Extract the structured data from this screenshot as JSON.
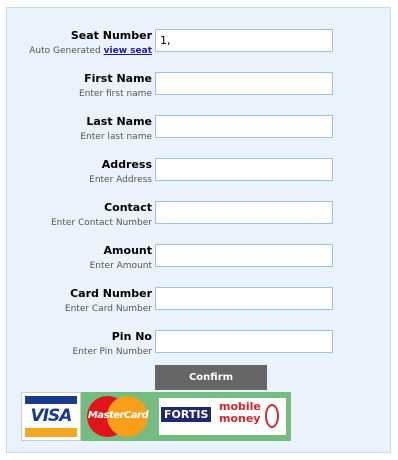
{
  "form": {
    "fields": [
      {
        "key": "seat",
        "label": "Seat Number",
        "hint": "Auto Generated",
        "hint_link": "view seat",
        "value": "1,",
        "placeholder": ""
      },
      {
        "key": "first_name",
        "label": "First Name",
        "hint": "Enter first name",
        "value": "",
        "placeholder": ""
      },
      {
        "key": "last_name",
        "label": "Last Name",
        "hint": "Enter last name",
        "value": "",
        "placeholder": ""
      },
      {
        "key": "address",
        "label": "Address",
        "hint": "Enter Address",
        "value": "",
        "placeholder": ""
      },
      {
        "key": "contact",
        "label": "Contact",
        "hint": "Enter Contact Number",
        "value": "",
        "placeholder": ""
      },
      {
        "key": "amount",
        "label": "Amount",
        "hint": "Enter Amount",
        "value": "",
        "placeholder": ""
      },
      {
        "key": "card_number",
        "label": "Card Number",
        "hint": "Enter Card Number",
        "value": "",
        "placeholder": ""
      },
      {
        "key": "pin",
        "label": "Pin No",
        "hint": "Enter Pin Number",
        "value": "",
        "placeholder": ""
      }
    ],
    "confirm_label": "Confirm"
  },
  "payment_logos": {
    "visa": {
      "text": "VISA",
      "icon": "visa-logo"
    },
    "mastercard": {
      "text": "MasterCard",
      "icon": "mastercard-logo"
    },
    "fortis": {
      "text": "FORTIS",
      "line1": "mobile",
      "line2": "money",
      "icon": "fortis-mobile-money-logo"
    }
  },
  "colors": {
    "panel_bg": "#eaf3fb",
    "field_border": "#9ec1de",
    "button_bg": "#666666",
    "logo_strip_bg": "#74bc80",
    "link": "#1a1aa6"
  }
}
